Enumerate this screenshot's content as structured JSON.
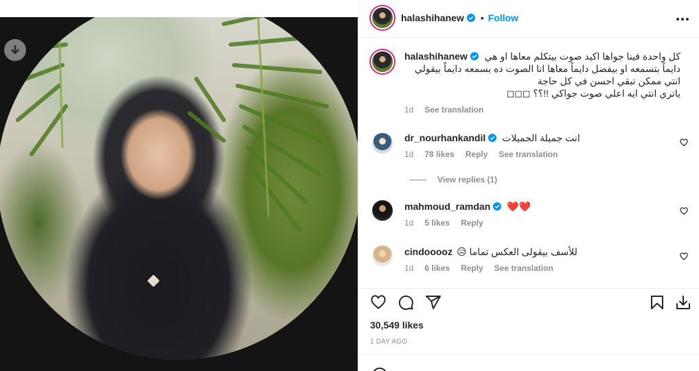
{
  "post": {
    "author": "halashihanew",
    "follow_label": "Follow",
    "dot": "•"
  },
  "caption": {
    "author": "halashihanew",
    "lines": [
      "كل واحدة فينا جواها اكيد صوت بيتكلم معاها او هي",
      "دايماً بتسمعه او بيفضل دايماً معاها انا الصوت ده بسمعه دايماً بيقولي",
      "انتي ممكن تبقي احسن في كل حاجة",
      "ياتري انتي ايه اعلي صوت جواكي !!؟؟ ◻◻◻"
    ],
    "age": "1d",
    "see_translation": "See translation"
  },
  "comments": [
    {
      "user": "dr_nourhankandil",
      "verified": true,
      "text": "انت جميلة الجميلات",
      "age": "1d",
      "likes": "78 likes",
      "reply": "Reply",
      "see_translation": "See translation",
      "view_replies": "View replies (1)"
    },
    {
      "user": "mahmoud_ramdan",
      "verified": true,
      "text": "❤️❤️",
      "age": "1d",
      "likes": "5 likes",
      "reply": "Reply"
    },
    {
      "user": "cindooooz",
      "verified": false,
      "text": "للأسف بيقولى العكس تماما 😥",
      "age": "1d",
      "likes": "6 likes",
      "reply": "Reply",
      "see_translation": "See translation"
    }
  ],
  "stats": {
    "likes": "30,549 likes",
    "date": "1 DAY AGO"
  },
  "icons": {
    "download": "download-icon",
    "more": "more-options-icon",
    "like": "heart-icon",
    "comment": "comment-icon",
    "share": "share-icon",
    "save": "bookmark-icon",
    "save_post": "save-download-icon",
    "emoji": "emoji-icon"
  },
  "colors": {
    "accent": "#0095f6",
    "verified": "#0095f6",
    "muted": "#8e8e8e",
    "text": "#262626"
  }
}
